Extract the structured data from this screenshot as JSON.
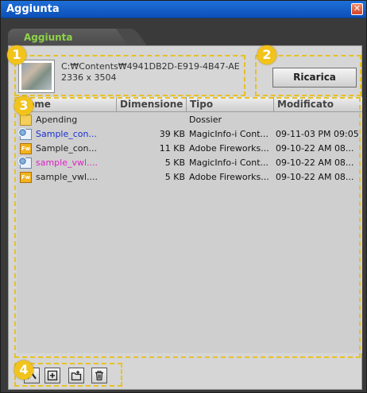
{
  "window": {
    "title": "Aggiunta",
    "close_glyph": "✕"
  },
  "tab": {
    "label": "Aggiunta"
  },
  "badges": [
    "1",
    "2",
    "3",
    "4"
  ],
  "info": {
    "path": "C:₩Contents₩4941DB2D-E919-4B47-AE",
    "dimensions": "2336 x 3504"
  },
  "reload_button": {
    "label": "Ricarica"
  },
  "columns": [
    "Nome",
    "Dimensione",
    "Tipo",
    "Modificato"
  ],
  "files": [
    {
      "name": "Apending",
      "size": "",
      "type": "Dossier",
      "modified": "",
      "icon": "folder-icon",
      "color": "#222222"
    },
    {
      "name": "Sample_con...",
      "size": "39 KB",
      "type": "MagicInfo-i Cont...",
      "modified": "09-11-03 PM 09:05",
      "icon": "magicinfo-file-icon",
      "color": "#1a2fd0"
    },
    {
      "name": "Sample_con...",
      "size": "11 KB",
      "type": "Adobe Fireworks...",
      "modified": "09-10-22 AM 08...",
      "icon": "fireworks-file-icon",
      "color": "#222222"
    },
    {
      "name": "sample_vwl....",
      "size": "5 KB",
      "type": "MagicInfo-i Cont...",
      "modified": "09-10-22 AM 08...",
      "icon": "magicinfo-file-icon",
      "color": "#e020c8"
    },
    {
      "name": "sample_vwl....",
      "size": "5 KB",
      "type": "Adobe Fireworks...",
      "modified": "09-10-22 AM 08...",
      "icon": "fireworks-file-icon",
      "color": "#222222"
    }
  ],
  "toolbar": [
    {
      "icon": "up-folder-icon"
    },
    {
      "icon": "add-file-icon"
    },
    {
      "icon": "new-folder-icon"
    },
    {
      "icon": "trash-icon"
    }
  ],
  "colors": {
    "titlebar": "#0d4fb8",
    "tab_text": "#8fd24a",
    "dash": "#e7c127",
    "badge": "#f2c31b"
  }
}
